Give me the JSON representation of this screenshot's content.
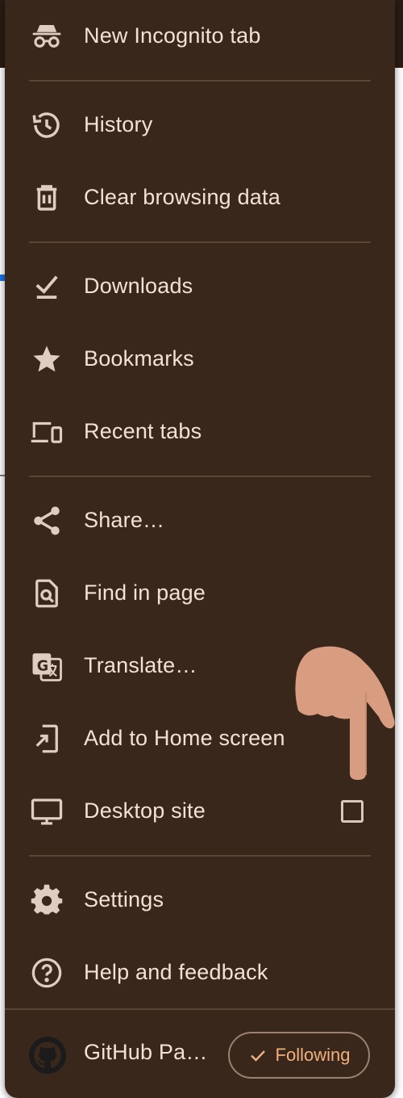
{
  "menu": {
    "items": [
      {
        "label": "New Incognito tab",
        "icon": "incognito-icon"
      },
      {
        "label": "History",
        "icon": "history-icon"
      },
      {
        "label": "Clear browsing data",
        "icon": "trash-icon"
      },
      {
        "label": "Downloads",
        "icon": "download-icon"
      },
      {
        "label": "Bookmarks",
        "icon": "star-icon"
      },
      {
        "label": "Recent tabs",
        "icon": "devices-icon"
      },
      {
        "label": "Share…",
        "icon": "share-icon"
      },
      {
        "label": "Find in page",
        "icon": "find-in-page-icon"
      },
      {
        "label": "Translate…",
        "icon": "translate-icon"
      },
      {
        "label": "Add to Home screen",
        "icon": "add-to-home-icon"
      },
      {
        "label": "Desktop site",
        "icon": "desktop-icon",
        "checked": false
      },
      {
        "label": "Settings",
        "icon": "gear-icon"
      },
      {
        "label": "Help and feedback",
        "icon": "help-icon"
      }
    ],
    "footer": {
      "site_label": "GitHub Pa…",
      "site_icon": "github-icon",
      "following_label": "Following",
      "following_icon": "checkmark-icon"
    }
  },
  "colors": {
    "menu_bg": "#3a271b",
    "text": "#f1e1d6",
    "icon": "#dfcdc1",
    "accent": "#f0b07e",
    "divider": "#5a4537"
  }
}
